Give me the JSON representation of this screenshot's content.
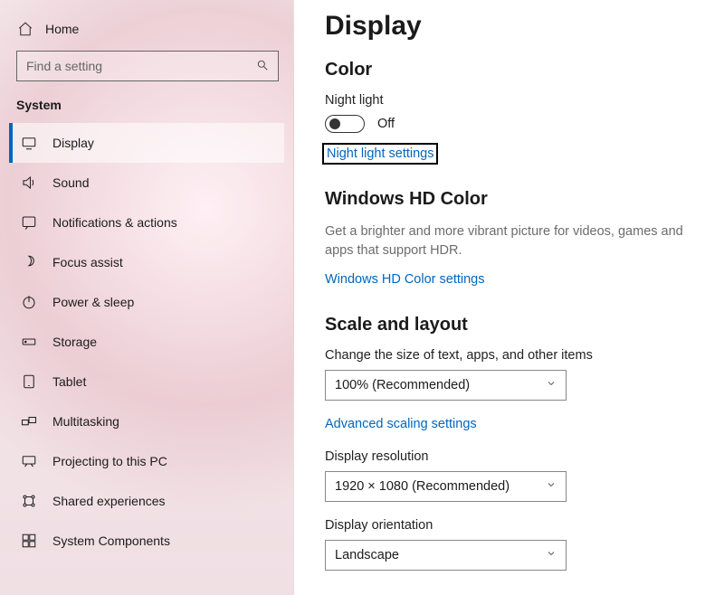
{
  "sidebar": {
    "home_label": "Home",
    "search_placeholder": "Find a setting",
    "group_label": "System",
    "items": [
      {
        "label": "Display"
      },
      {
        "label": "Sound"
      },
      {
        "label": "Notifications & actions"
      },
      {
        "label": "Focus assist"
      },
      {
        "label": "Power & sleep"
      },
      {
        "label": "Storage"
      },
      {
        "label": "Tablet"
      },
      {
        "label": "Multitasking"
      },
      {
        "label": "Projecting to this PC"
      },
      {
        "label": "Shared experiences"
      },
      {
        "label": "System Components"
      }
    ]
  },
  "page": {
    "title": "Display",
    "color": {
      "heading": "Color",
      "night_light_label": "Night light",
      "night_light_state": "Off",
      "night_light_link": "Night light settings"
    },
    "hdcolor": {
      "heading": "Windows HD Color",
      "description": "Get a brighter and more vibrant picture for videos, games and apps that support HDR.",
      "link": "Windows HD Color settings"
    },
    "scale": {
      "heading": "Scale and layout",
      "text_size_label": "Change the size of text, apps, and other items",
      "text_size_value": "100% (Recommended)",
      "advanced_link": "Advanced scaling settings",
      "resolution_label": "Display resolution",
      "resolution_value": "1920 × 1080 (Recommended)",
      "orientation_label": "Display orientation",
      "orientation_value": "Landscape"
    }
  }
}
